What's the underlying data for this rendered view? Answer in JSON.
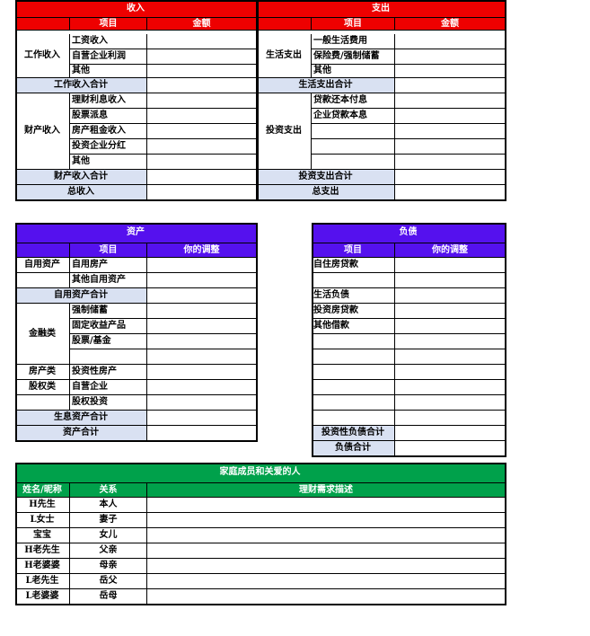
{
  "income": {
    "title": "收入",
    "col_item": "项目",
    "col_amount": "金额",
    "group_work": "工作收入",
    "work_items": [
      "工资收入",
      "自营企业利润",
      "其他"
    ],
    "work_total": "工作收入合计",
    "group_asset": "财产收入",
    "asset_items": [
      "理财利息收入",
      "股票派息",
      "房产租金收入",
      "投资企业分红",
      "其他"
    ],
    "asset_total": "财产收入合计",
    "total": "总收入"
  },
  "expense": {
    "title": "支出",
    "col_item": "项目",
    "col_amount": "金额",
    "group_living": "生活支出",
    "living_items": [
      "一般生活费用",
      "保险费/强制储蓄",
      "其他"
    ],
    "living_total": "生活支出合计",
    "group_invest": "投资支出",
    "invest_items": [
      "贷款还本付息",
      "企业贷款本息",
      "",
      "",
      ""
    ],
    "invest_total": "投资支出合计",
    "total": "总支出"
  },
  "assets": {
    "title": "资产",
    "col_item": "项目",
    "col_adjust": "你的调整",
    "group_self": "自用资产",
    "self_items": [
      "自用房产",
      "其他自用资产"
    ],
    "self_total": "自用资产合计",
    "group_fin": "金融类",
    "fin_items": [
      "强制储蓄",
      "固定收益产品",
      "股票/基金",
      ""
    ],
    "group_property": "房产类",
    "property_items": [
      "投资性房产"
    ],
    "group_equity": "股权类",
    "equity_items": [
      "自营企业",
      "股权投资"
    ],
    "earning_total": "生息资产合计",
    "total": "资产合计"
  },
  "liabilities": {
    "title": "负债",
    "col_item": "项目",
    "col_adjust": "你的调整",
    "items": [
      "自住房贷款",
      "",
      "生活负债",
      "投资房贷款",
      "其他借款",
      "",
      "",
      "",
      "",
      "",
      ""
    ],
    "invest_total": "投资性负债合计",
    "total": "负债合计"
  },
  "family": {
    "title": "家庭成员和关爱的人",
    "col_name": "姓名/昵称",
    "col_relation": "关系",
    "col_needs": "理财需求描述",
    "members": [
      {
        "name": "H先生",
        "relation": "本人"
      },
      {
        "name": "L女士",
        "relation": "妻子"
      },
      {
        "name": "宝宝",
        "relation": "女儿"
      },
      {
        "name": "H老先生",
        "relation": "父亲"
      },
      {
        "name": "H老婆婆",
        "relation": "母亲"
      },
      {
        "name": "L老先生",
        "relation": "岳父"
      },
      {
        "name": "L老婆婆",
        "relation": "岳母"
      }
    ]
  },
  "colors": {
    "income_header": "#ee0000",
    "asset_header": "#5511ee",
    "family_header": "#00a14b",
    "subtotal_fill": "#d9e1f2"
  }
}
